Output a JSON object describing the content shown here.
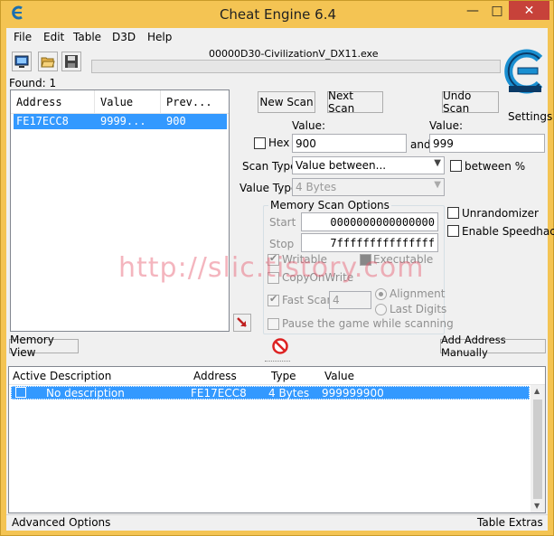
{
  "title": "Cheat Engine 6.4",
  "window_controls": {
    "minimize": "—",
    "maximize": "□",
    "close": "✕"
  },
  "menu": [
    "File",
    "Edit",
    "Table",
    "D3D",
    "Help"
  ],
  "process_name": "00000D30-CivilizationV_DX11.exe",
  "found_label": "Found: 1",
  "results_list": {
    "headers": [
      "Address",
      "Value",
      "Prev..."
    ],
    "rows": [
      {
        "address": "FE17ECC8",
        "value": "9999...",
        "previous": "900"
      }
    ]
  },
  "buttons": {
    "new_scan": "New Scan",
    "next_scan": "Next Scan",
    "undo_scan": "Undo Scan",
    "settings": "Settings",
    "memory_view": "Memory View",
    "add_address_manually": "Add Address Manually"
  },
  "scan": {
    "value_label_1": "Value:",
    "value_label_2": "Value:",
    "hex_label": "Hex",
    "value_1": "900",
    "and_label": "and",
    "value_2": "999",
    "scan_type_label": "Scan Type",
    "scan_type_value": "Value between...",
    "between_percent_label": "between %",
    "value_type_label": "Value Type",
    "value_type_value": "4 Bytes"
  },
  "memory_options": {
    "title": "Memory Scan Options",
    "start_label": "Start",
    "start_value": "0000000000000000",
    "stop_label": "Stop",
    "stop_value": "7fffffffffffffff",
    "writable_label": "Writable",
    "executable_label": "Executable",
    "copy_on_write_label": "CopyOnWrite",
    "fast_scan_label": "Fast Scan",
    "fast_scan_value": "4",
    "alignment_label": "Alignment",
    "last_digits_label": "Last Digits",
    "pause_label": "Pause the game while scanning"
  },
  "options": {
    "unrandomizer_label": "Unrandomizer",
    "speedhack_label": "Enable Speedhack"
  },
  "watermark": "http://slic.tistory.com",
  "address_table": {
    "headers": [
      "Active",
      "Description",
      "Address",
      "Type",
      "Value"
    ],
    "rows": [
      {
        "description": "No description",
        "address": "FE17ECC8",
        "type": "4 Bytes",
        "value": "999999900"
      }
    ]
  },
  "status_bar": {
    "left": "Advanced Options",
    "right": "Table Extras"
  },
  "colors": {
    "selection": "#3399ff",
    "frame": "#f4c453",
    "logo": "#1a8fd1"
  }
}
